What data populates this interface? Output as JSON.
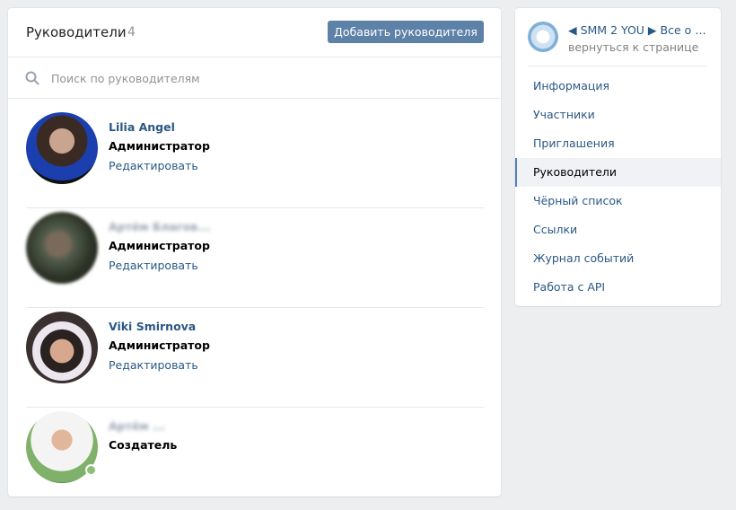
{
  "main": {
    "title": "Руководители",
    "count": "4",
    "add_button": "Добавить руководителя",
    "search_placeholder": "Поиск по руководителям",
    "rows": [
      {
        "name": "Lilia Angel",
        "role": "Администратор",
        "edit": "Редактировать",
        "online": false
      },
      {
        "name": "Артём Благов...",
        "role": "Администратор",
        "edit": "Редактировать",
        "online": false
      },
      {
        "name": "Viki Smirnova",
        "role": "Администратор",
        "edit": "Редактировать",
        "online": false
      },
      {
        "name": "Артём ...",
        "role": "Создатель",
        "edit": "",
        "online": true
      }
    ]
  },
  "sidebar": {
    "community_link": "◀ SMM 2 YOU ▶ Все о п...",
    "back": "вернуться к странице",
    "items": [
      {
        "label": "Информация",
        "active": false
      },
      {
        "label": "Участники",
        "active": false
      },
      {
        "label": "Приглашения",
        "active": false
      },
      {
        "label": "Руководители",
        "active": true
      },
      {
        "label": "Чёрный список",
        "active": false
      },
      {
        "label": "Ссылки",
        "active": false
      },
      {
        "label": "Журнал событий",
        "active": false
      },
      {
        "label": "Работа с API",
        "active": false
      }
    ]
  },
  "colors": {
    "accent": "#5e81a8",
    "link": "#2a5885",
    "background": "#edeef0",
    "online": "#8ac176"
  }
}
